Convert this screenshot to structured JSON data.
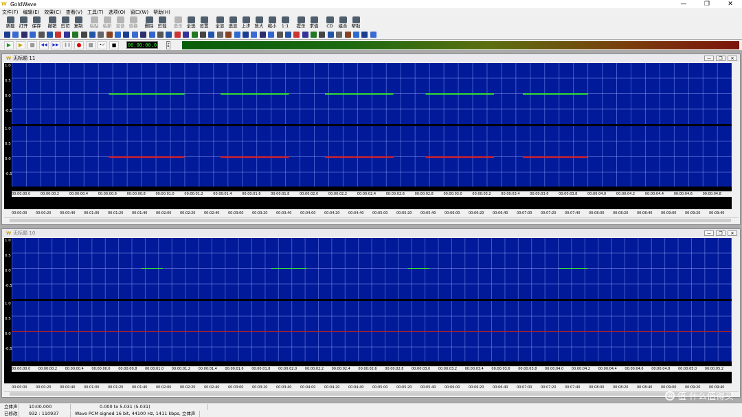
{
  "app": {
    "title": "GoldWave",
    "logo": "W"
  },
  "window_controls": {
    "minimize": "—",
    "maximize": "❐",
    "close": "✕"
  },
  "menu": [
    "文件(F)",
    "编辑(E)",
    "效果(C)",
    "查看(V)",
    "工具(T)",
    "选项(O)",
    "窗口(W)",
    "帮助(H)"
  ],
  "toolbar": {
    "buttons": [
      {
        "label": "新建",
        "enabled": true
      },
      {
        "label": "打开",
        "enabled": true
      },
      {
        "label": "保存",
        "enabled": true
      },
      {
        "label": "撤销",
        "enabled": true
      },
      {
        "label": "剪切",
        "enabled": true
      },
      {
        "label": "复制",
        "enabled": true
      },
      {
        "label": "粘贴",
        "enabled": false
      },
      {
        "label": "粘新",
        "enabled": false
      },
      {
        "label": "混音",
        "enabled": false
      },
      {
        "label": "替换",
        "enabled": false
      },
      {
        "label": "删除",
        "enabled": true
      },
      {
        "label": "剪裁",
        "enabled": true
      },
      {
        "label": "选示",
        "enabled": false
      },
      {
        "label": "全选",
        "enabled": true
      },
      {
        "label": "设置",
        "enabled": true
      },
      {
        "label": "全显",
        "enabled": true
      },
      {
        "label": "选显",
        "enabled": true
      },
      {
        "label": "上步",
        "enabled": true
      },
      {
        "label": "放大",
        "enabled": true
      },
      {
        "label": "缩小",
        "enabled": true
      },
      {
        "label": "1:1",
        "enabled": true
      },
      {
        "label": "提示",
        "enabled": true
      },
      {
        "label": "求值",
        "enabled": true
      },
      {
        "label": "CD",
        "enabled": true
      },
      {
        "label": "组合",
        "enabled": true
      },
      {
        "label": "帮助",
        "enabled": true
      }
    ]
  },
  "transport": {
    "time": "00:00:00.0",
    "play": "▶",
    "play_sel": "▶",
    "stop": "■",
    "rewind": "◀◀",
    "forward": "▶▶",
    "pause": "❚❚",
    "record": "●",
    "record_sel": "■",
    "loop": "•✓",
    "meter_label": "L R"
  },
  "windows": [
    {
      "title": "无标题 11",
      "active": true,
      "y_labels": [
        "1.0",
        "0.5",
        "0.0",
        "-0.5"
      ],
      "ruler": [
        "00:00:00.0",
        "00:00:00.2",
        "00:00:00.4",
        "00:00:00.6",
        "00:00:00.8",
        "00:00:01.0",
        "00:00:01.2",
        "00:00:01.4",
        "00:00:01.6",
        "00:00:01.8",
        "00:00:02.0",
        "00:00:02.2",
        "00:00:02.4",
        "00:00:02.6",
        "00:00:02.8",
        "00:00:03.0",
        "00:00:03.2",
        "00:00:03.4",
        "00:00:03.6",
        "00:00:03.8",
        "00:00:04.0",
        "00:00:04.2",
        "00:00:04.4",
        "00:00:04.6",
        "00:00:04.8"
      ],
      "overview_ruler": [
        "00:00:00",
        "00:00:20",
        "00:00:40",
        "00:01:00",
        "00:01:20",
        "00:01:40",
        "00:02:00",
        "00:02:20",
        "00:02:40",
        "00:03:00",
        "00:03:20",
        "00:03:40",
        "00:04:00",
        "00:04:20",
        "00:04:40",
        "00:05:00",
        "00:05:20",
        "00:05:40",
        "00:06:00",
        "00:06:20",
        "00:06:40",
        "00:07:00",
        "00:07:20",
        "00:07:40",
        "00:08:00",
        "00:08:20",
        "00:08:40",
        "00:09:00",
        "00:09:20",
        "00:09:40"
      ]
    },
    {
      "title": "无标题 10",
      "active": false,
      "y_labels": [
        "1.0",
        "0.5",
        "0.0",
        "-0.5"
      ],
      "ruler": [
        "00:00:00.0",
        "00:00:00.2",
        "00:00:00.4",
        "00:00:00.6",
        "00:00:00.8",
        "00:00:01.0",
        "00:00:01.2",
        "00:00:01.4",
        "00:00:01.6",
        "00:00:01.8",
        "00:00:02.0",
        "00:00:02.2",
        "00:00:02.4",
        "00:00:02.6",
        "00:00:02.8",
        "00:00:03.0",
        "00:00:03.2",
        "00:00:03.4",
        "00:00:03.6",
        "00:00:03.8",
        "00:00:04.0",
        "00:00:04.2",
        "00:00:04.4",
        "00:00:04.6",
        "00:00:04.8",
        "00:00:05.0",
        "00:00:05.2"
      ],
      "overview_ruler": [
        "00:00:00",
        "00:00:20",
        "00:00:40",
        "00:01:00",
        "00:01:20",
        "00:01:40",
        "00:02:00",
        "00:02:20",
        "00:02:40",
        "00:03:00",
        "00:03:20",
        "00:03:40",
        "00:04:00",
        "00:04:20",
        "00:04:40",
        "00:05:00",
        "00:05:20",
        "00:05:40",
        "00:06:00",
        "00:06:20",
        "00:06:40",
        "00:07:00",
        "00:07:20",
        "00:07:40",
        "00:08:00",
        "00:08:20",
        "00:08:40",
        "00:09:00",
        "00:09:20",
        "00:09:40"
      ]
    }
  ],
  "status": {
    "row1": [
      "立体声",
      "10:00.000",
      "0.000 to 5.031 (5.031)"
    ],
    "row2": [
      "已修改",
      "932 : 110937",
      "Wave PCM signed 16 bit, 44100 Hz, 1411 kbps, 立体声"
    ]
  },
  "watermark": {
    "text": "值 什么值得买",
    "icon": "值"
  },
  "colors": {
    "wave_bg": "#001a99",
    "left_channel": "#33dd33",
    "right_channel": "#dd2222",
    "grid": "#96aaff"
  }
}
